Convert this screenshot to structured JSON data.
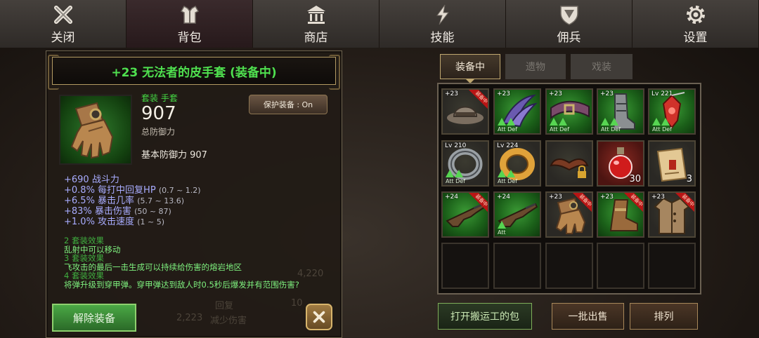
{
  "nav": {
    "tabs": [
      {
        "label": "关闭",
        "icon": "close-icon"
      },
      {
        "label": "背包",
        "icon": "armor-icon",
        "active": true
      },
      {
        "label": "商店",
        "icon": "temple-icon"
      },
      {
        "label": "技能",
        "icon": "lightning-icon"
      },
      {
        "label": "佣兵",
        "icon": "shield-icon"
      },
      {
        "label": "设置",
        "icon": "gear-icon"
      }
    ]
  },
  "item": {
    "title": "+23 无法者的皮手套 (装备中)",
    "set_label": "套装 手套",
    "defense_value": "907",
    "defense_label": "总防御力",
    "base_defense": "基本防御力 907",
    "protect_button": "保护装备 : On",
    "stats": [
      {
        "text": "+690 战斗力",
        "range": ""
      },
      {
        "text": "+0.8% 每打中回复HP",
        "range": "(0.7 ~ 1.2)"
      },
      {
        "text": "+6.5% 暴击几率",
        "range": "(5.7 ~ 13.6)"
      },
      {
        "text": "+83% 暴击伤害",
        "range": "(50 ~ 87)"
      },
      {
        "text": "+1.0% 攻击速度",
        "range": "(1 ~ 5)"
      }
    ],
    "set_effects": [
      {
        "head": "2 套装效果",
        "text": "乱射中可以移动"
      },
      {
        "head": "3 套装效果",
        "text": "飞攻击的最后一击生成可以持续给伤害的熔岩地区"
      },
      {
        "head": "4 套装效果",
        "text": "将弹升级到穿甲弹。穿甲弹达到敌人时0.5秒后爆发并有范围伤害?"
      }
    ],
    "unequip_button": "解除装备",
    "ghost_text": [
      "4,220",
      "10",
      "2,223",
      "减少伤害",
      "回复"
    ]
  },
  "inventory": {
    "tabs": [
      {
        "label": "装备中",
        "active": true
      },
      {
        "label": "遗物",
        "active": false
      },
      {
        "label": "戏装",
        "active": false
      }
    ],
    "slots": [
      {
        "icon": "hat-icon",
        "level": "+23",
        "equipped": true,
        "equipped_label": "装备中",
        "style": "gold",
        "arrows": 0,
        "att_def": ""
      },
      {
        "icon": "claw-icon",
        "level": "+23",
        "equipped": false,
        "style": "green",
        "arrows": 2,
        "att_def": "Att Def"
      },
      {
        "icon": "belt-icon",
        "level": "+23",
        "equipped": false,
        "style": "green",
        "arrows": 2,
        "att_def": "Att Def"
      },
      {
        "icon": "greaves-icon",
        "level": "+23",
        "equipped": false,
        "style": "green",
        "arrows": 2,
        "att_def": "Att Def"
      },
      {
        "icon": "amulet-icon",
        "level": "Lv 221",
        "equipped": false,
        "style": "green",
        "arrows": 2,
        "att_def": "Att Def"
      },
      {
        "icon": "ring-icon",
        "level": "Lv 210",
        "equipped": false,
        "style": "gold",
        "arrows": 2,
        "att_def": "Att Def"
      },
      {
        "icon": "gold-ring-icon",
        "level": "Lv 224",
        "equipped": false,
        "style": "gold",
        "arrows": 2,
        "att_def": "Att Def"
      },
      {
        "icon": "wings-lock-icon",
        "level": "",
        "equipped": false,
        "style": "gold",
        "arrows": 0,
        "att_def": ""
      },
      {
        "icon": "potion-icon",
        "level": "",
        "equipped": false,
        "style": "red",
        "arrows": 0,
        "att_def": "",
        "count": "30"
      },
      {
        "icon": "scroll-icon",
        "level": "",
        "equipped": false,
        "style": "gold",
        "arrows": 0,
        "att_def": "",
        "count": "3"
      },
      {
        "icon": "rifle-icon",
        "level": "+24",
        "equipped": true,
        "equipped_label": "装备中",
        "style": "green",
        "arrows": 0,
        "att_def": ""
      },
      {
        "icon": "rifle-icon",
        "level": "+24",
        "equipped": false,
        "style": "green",
        "arrows": 1,
        "att_def": "Att"
      },
      {
        "icon": "glove-icon",
        "level": "+23",
        "equipped": true,
        "equipped_label": "装备中",
        "style": "gold",
        "arrows": 0,
        "att_def": ""
      },
      {
        "icon": "boot-icon",
        "level": "+23",
        "equipped": true,
        "equipped_label": "装备中",
        "style": "green",
        "arrows": 0,
        "att_def": ""
      },
      {
        "icon": "coat-icon",
        "level": "+23",
        "equipped": true,
        "equipped_label": "装备中",
        "style": "gold",
        "arrows": 0,
        "att_def": ""
      },
      {
        "icon": "",
        "level": "",
        "equipped": false,
        "style": "empty",
        "arrows": 0,
        "att_def": ""
      },
      {
        "icon": "",
        "level": "",
        "equipped": false,
        "style": "empty",
        "arrows": 0,
        "att_def": ""
      },
      {
        "icon": "",
        "level": "",
        "equipped": false,
        "style": "empty",
        "arrows": 0,
        "att_def": ""
      },
      {
        "icon": "",
        "level": "",
        "equipped": false,
        "style": "empty",
        "arrows": 0,
        "att_def": ""
      },
      {
        "icon": "",
        "level": "",
        "equipped": false,
        "style": "empty",
        "arrows": 0,
        "att_def": ""
      }
    ]
  },
  "bottom_buttons": {
    "porter_bag": "打开搬运工的包",
    "bulk_sell": "一批出售",
    "sort": "排列"
  }
}
